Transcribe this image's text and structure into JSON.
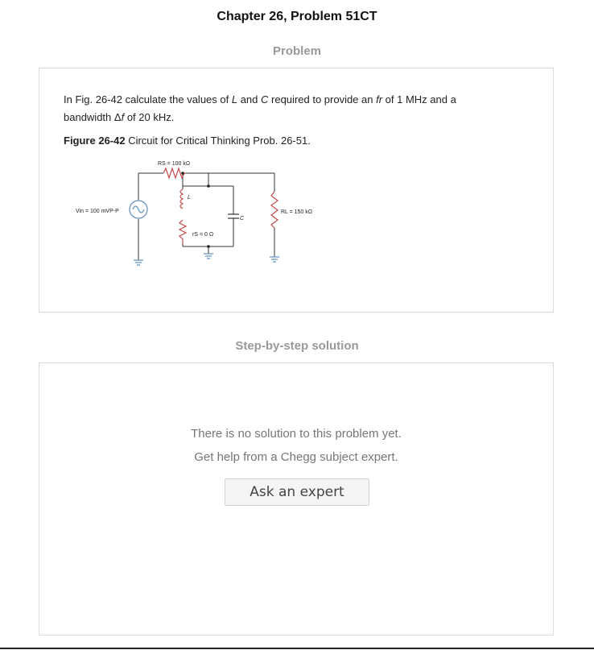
{
  "page": {
    "title": "Chapter 26, Problem 51CT"
  },
  "problem": {
    "heading": "Problem",
    "text_line1_a": "In Fig. 26-42 calculate the values of ",
    "text_L": "L",
    "text_line1_b": " and ",
    "text_C": "C",
    "text_line1_c": " required to provide an ",
    "text_fr": "fr",
    "text_line1_d": " of 1 MHz and a",
    "text_line2_a": "bandwidth Δ",
    "text_f": "f",
    "text_line2_b": " of 20 kHz.",
    "figure_label": "Figure 26-42",
    "figure_caption": " Circuit for Critical Thinking Prob. 26-51.",
    "circuit": {
      "rs_label": "RS = 100 kΩ",
      "l_label": "L",
      "c_label": "C",
      "rl_label": "RL = 150 kΩ",
      "vin_label": "Vin = 100 mVP-P",
      "rs0_label": "rS = 0 Ω"
    }
  },
  "solution": {
    "heading": "Step-by-step solution",
    "message_line1": "There is no solution to this problem yet.",
    "message_line2": "Get help from a Chegg subject expert.",
    "ask_button_label": "Ask an expert"
  },
  "colors": {
    "accent_wire": "#5a8fbf",
    "heading_gray": "#999999"
  }
}
